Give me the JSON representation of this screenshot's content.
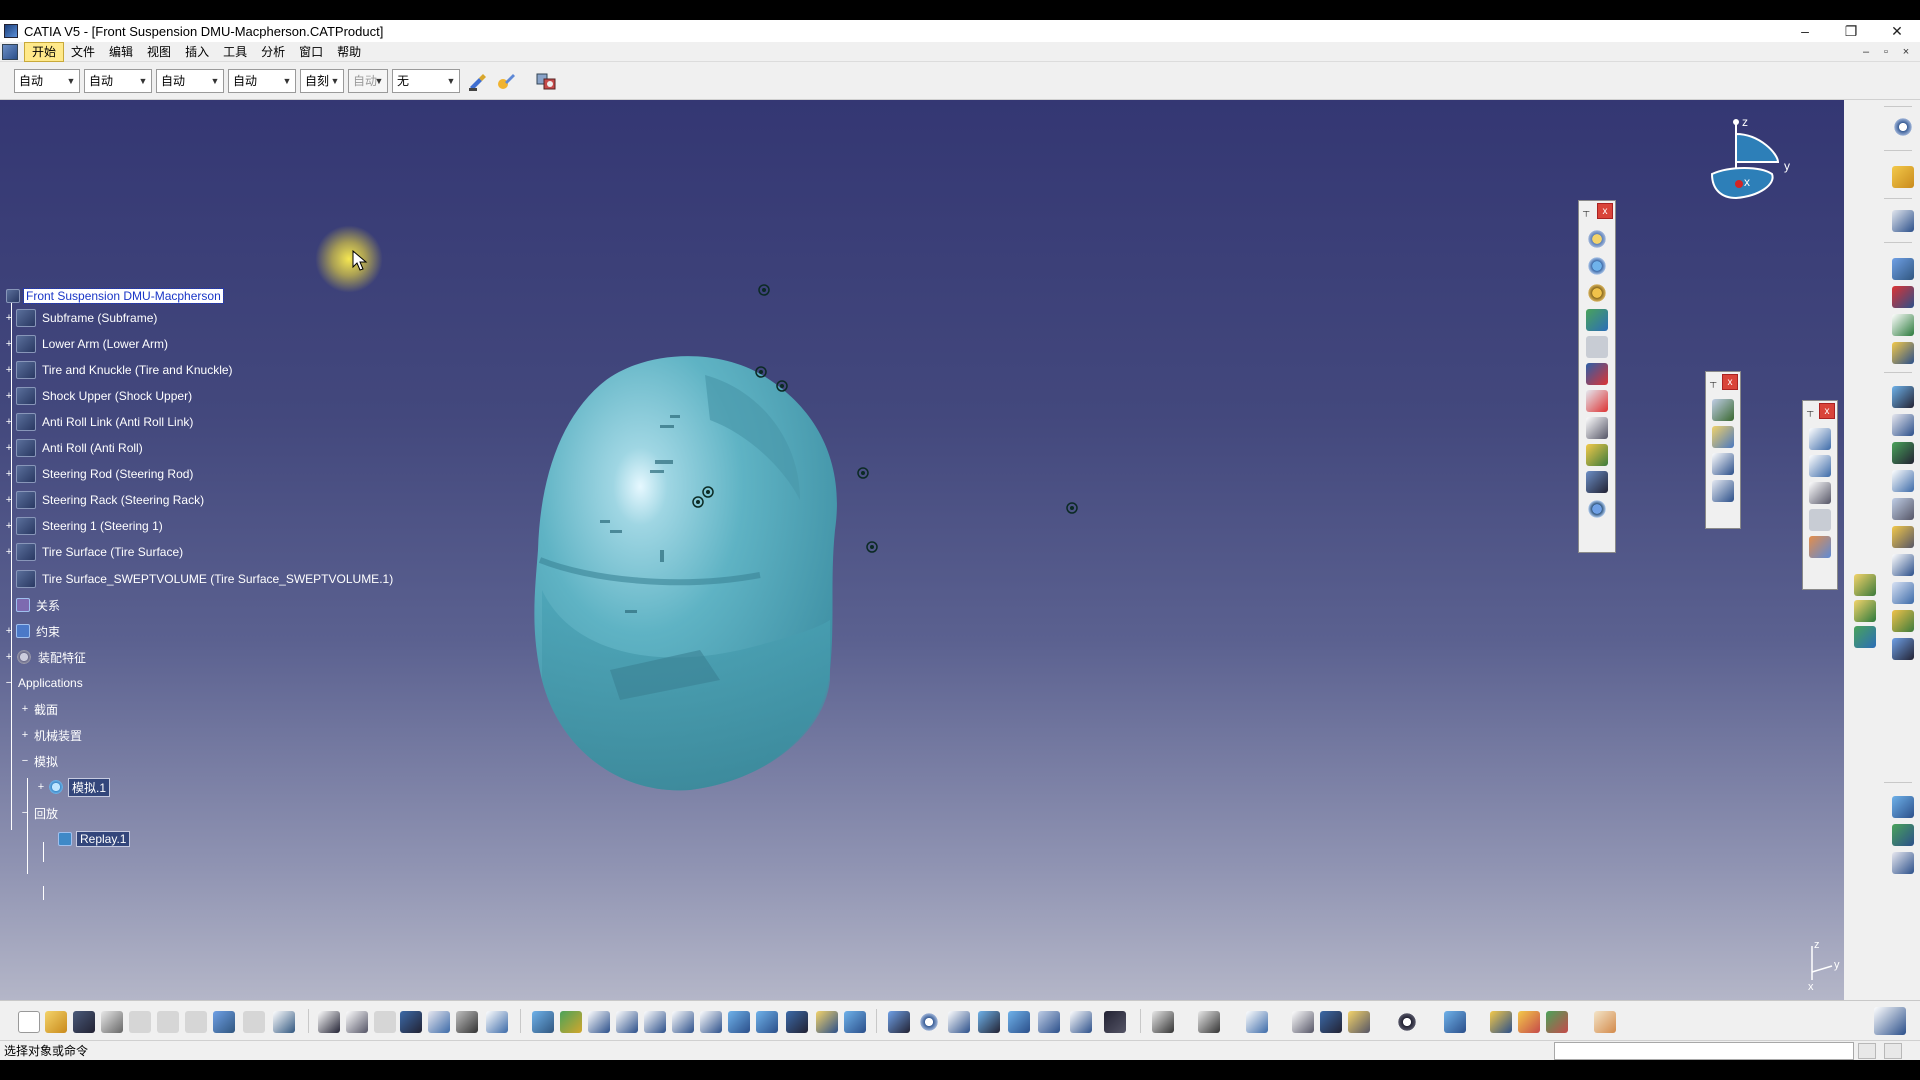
{
  "window": {
    "title": "CATIA V5 - [Front Suspension DMU-Macpherson.CATProduct]",
    "controls": [
      "–",
      "❐",
      "✕"
    ]
  },
  "menubar": {
    "items": [
      "开始",
      "文件",
      "编辑",
      "视图",
      "插入",
      "工具",
      "分析",
      "窗口",
      "帮助"
    ],
    "active": "开始",
    "mdi_controls": [
      "–",
      "▫",
      "×"
    ]
  },
  "toolbar_top": {
    "combos": [
      {
        "value": "自动"
      },
      {
        "value": "自动"
      },
      {
        "value": "自动"
      },
      {
        "value": "自动"
      },
      {
        "value": "自刻"
      },
      {
        "value": "自动"
      },
      {
        "value": "无"
      }
    ]
  },
  "tree": {
    "root": "Front Suspension DMU-Macpherson",
    "parts": [
      "Subframe (Subframe)",
      "Lower Arm (Lower Arm)",
      "Tire and Knuckle (Tire and Knuckle)",
      "Shock Upper (Shock Upper)",
      "Anti Roll Link (Anti Roll Link)",
      "Anti Roll (Anti Roll)",
      "Steering Rod (Steering Rod)",
      "Steering Rack (Steering Rack)",
      "Steering 1 (Steering 1)",
      "Tire Surface (Tire Surface)",
      "Tire Surface_SWEPTVOLUME (Tire Surface_SWEPTVOLUME.1)"
    ],
    "relations": "关系",
    "constraints": "约束",
    "assembly_features": "装配特征",
    "applications": "Applications",
    "app_children": [
      "截面",
      "机械装置",
      "模拟"
    ],
    "simulation_child": "模拟.1",
    "replay": "回放",
    "replay_child": "Replay.1"
  },
  "compass": {
    "z": "z",
    "y": "y",
    "x": "x"
  },
  "axis_small": {
    "z": "z",
    "y": "y",
    "x": "x"
  },
  "status": {
    "prompt": "选择对象或命令"
  },
  "colors": {
    "viewport_top": "#343773",
    "viewport_bottom": "#b4b6c8",
    "part_fill": "#5fb3c4",
    "selection_text": "#1a36c7",
    "menu_active": "#ffe98a"
  }
}
